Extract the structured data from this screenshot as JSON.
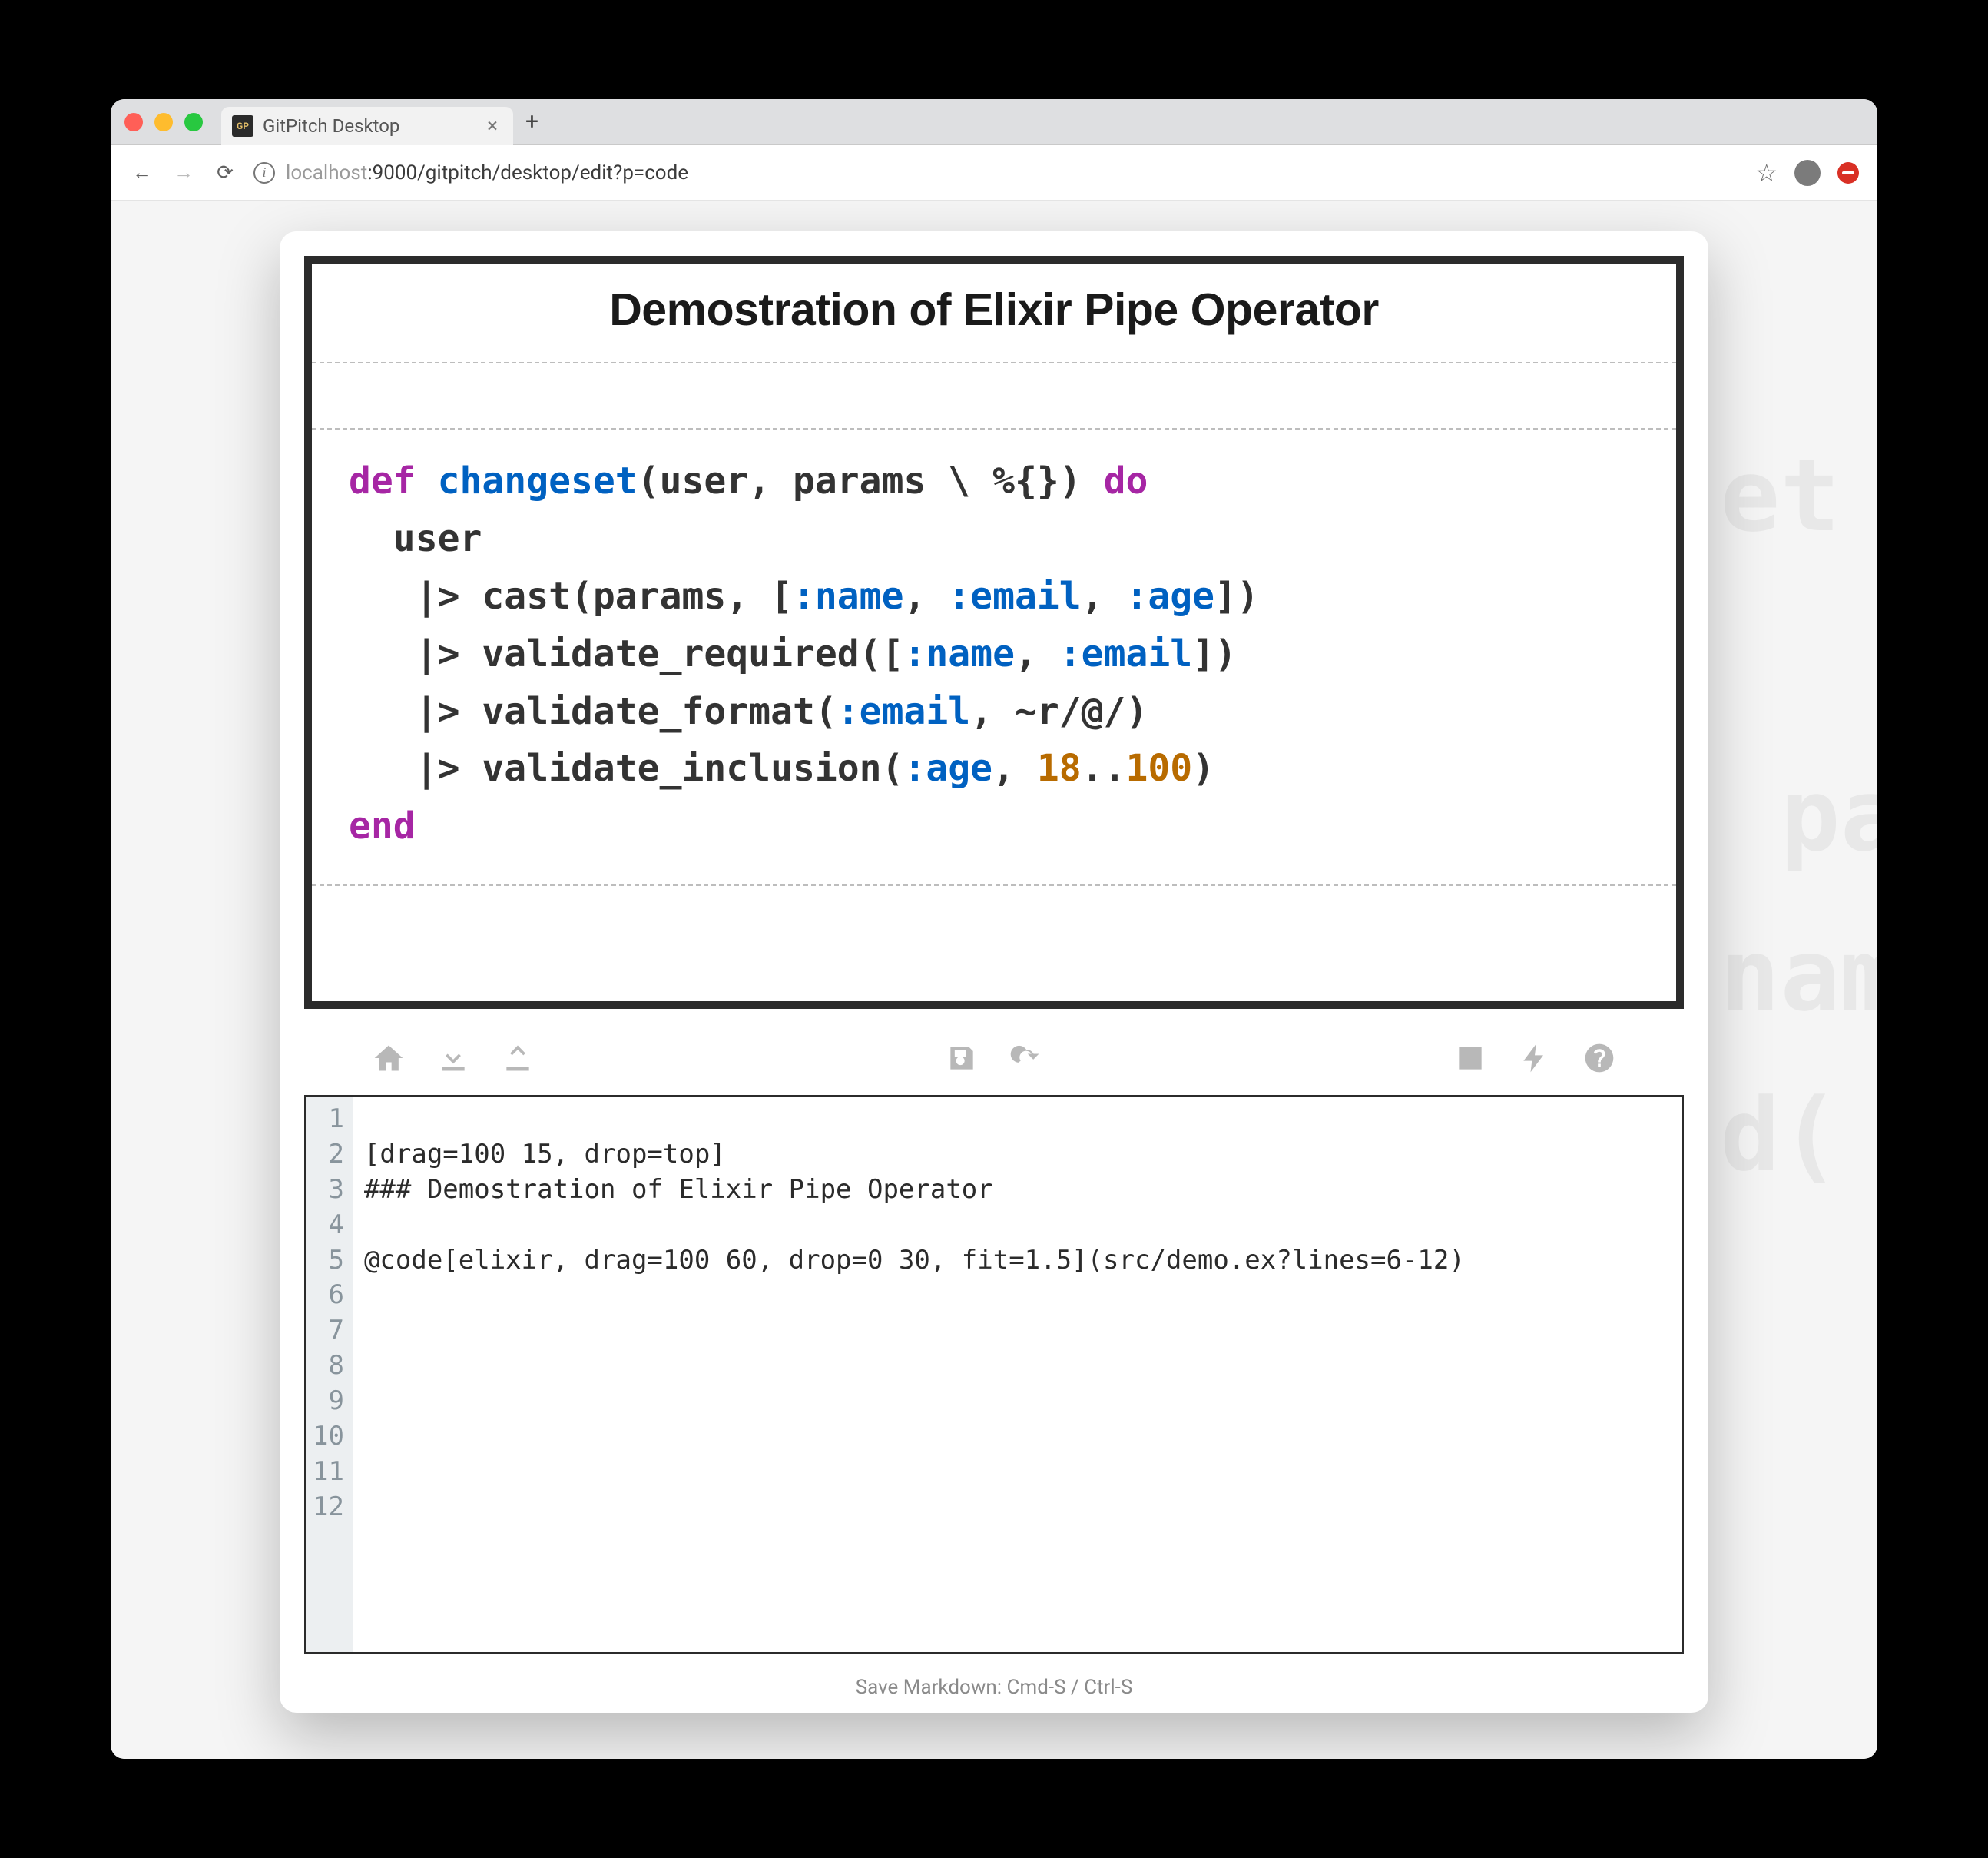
{
  "browser": {
    "tab_title": "GitPitch Desktop",
    "url_host_dim": "localhost",
    "url_port": ":9000",
    "url_path": "/gitpitch/desktop/edit?p=code"
  },
  "slide": {
    "title": "Demostration of Elixir Pipe Operator"
  },
  "code_tokens": {
    "l1_def": "def",
    "l1_fn": " changeset",
    "l1_rest": "(user, params \\ %{}) ",
    "l1_do": "do",
    "l2": "  user",
    "l3_pre": "   |> cast(params, [",
    "l3_s1": ":name",
    "l3_c1": ", ",
    "l3_s2": ":email",
    "l3_c2": ", ",
    "l3_s3": ":age",
    "l3_post": "])",
    "l4_pre": "   |> validate_required([",
    "l4_s1": ":name",
    "l4_c1": ", ",
    "l4_s2": ":email",
    "l4_post": "])",
    "l5_pre": "   |> validate_format(",
    "l5_s1": ":email",
    "l5_post": ", ~r/@/)",
    "l6_pre": "   |> validate_inclusion(",
    "l6_s1": ":age",
    "l6_c1": ", ",
    "l6_n1": "18",
    "l6_dots": "..",
    "l6_n2": "100",
    "l6_post": ")",
    "l7_end": "end"
  },
  "editor": {
    "line_count": 12,
    "lines": {
      "1": "",
      "2": "[drag=100 15, drop=top]",
      "3": "### Demostration of Elixir Pipe Operator",
      "4": "",
      "5": "@code[elixir, drag=100 60, drop=0 30, fit=1.5](src/demo.ex?lines=6-12)",
      "6": "",
      "7": "",
      "8": "",
      "9": "",
      "10": "",
      "11": "",
      "12": ""
    }
  },
  "statusbar": "Save Markdown: Cmd-S / Ctrl-S",
  "ghost": "et\n\n pa\nnam\nd("
}
